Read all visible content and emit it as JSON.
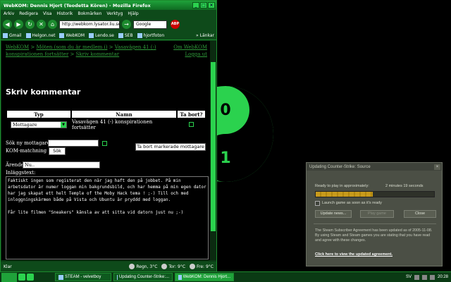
{
  "firefox": {
    "title": "WebKOM: Dennis Hjort (Teodetta Kören) - Mozilla Firefox",
    "menu": [
      "Arkiv",
      "Redigera",
      "Visa",
      "Historik",
      "Bokmärken",
      "Verktyg",
      "Hjälp"
    ],
    "url": "http://webkom.lysator.liu.se/",
    "search_value": "Google",
    "abp_label": "ABP",
    "bookmarks": [
      "Gmail",
      "Helgon.net",
      "WebKOM",
      "Lendo.se",
      "SEB",
      "hjortfoton"
    ],
    "bookmarks_more": "»",
    "bookmarks_overflow_label": "Länkar"
  },
  "page": {
    "breadcrumb": {
      "root": "WebKOM",
      "sep": " > ",
      "level1": "Möten (som du är medlem i)",
      "level2": "Vasavägen 41 (-) konspirationen fortsätter",
      "level3": "Skriv kommentar"
    },
    "right_links": [
      "Om WebKOM",
      "Logga ut"
    ],
    "title": "Skriv kommentar",
    "table": {
      "headers": [
        "Typ",
        "Namn",
        "Ta bort?"
      ],
      "row": {
        "type": "Mottagare",
        "name": "Vasavägen 41 (-) konspirationen fortsätter"
      }
    },
    "search_label": "Sök ny mottagare:",
    "kom_label": "KOM-matchning",
    "search_button": "Sök",
    "remove_button": "Ta bort markerade mottagare",
    "subject_label": "Ärende:",
    "subject_value": "Nu..",
    "body_label": "Inläggstext:",
    "body_text": "Faktiskt ingen som registerat den när jag haft den på jobbet. På min arbetsdator är numer loggan min bakgrundsbild, och har hemma på min egen dator har jag skapat ett helt Temple of the Moby Hack tema ! ;-) Till och med inloggningskärmen både på Vista och Ubuntu är pryddd med loggan.\n\nFår lite filmen \"Sneakers\" känsla av att sitta vid datorn just nu ;-)"
  },
  "statusbar": {
    "text": "Klar",
    "weather": [
      "Regn, 3°C",
      "Tor: 9°C",
      "Fre: 9°C"
    ]
  },
  "steam": {
    "title": "Updating Counter-Strike: Source",
    "ready_label": "Ready to play in approximately:",
    "time_left": "2 minutes 19 seconds",
    "progress": 0.48,
    "launch_label": "Launch game as soon as it's ready",
    "buttons": [
      "Update news...",
      "Play game",
      "Close"
    ],
    "agreement": "The Steam Subscriber Agreement has been updated as of 2005-11-08. By using Steam and Steam games you are stating that you have read and agree with these changes.",
    "link": "Click here to view the updated agreement."
  },
  "taskbar": {
    "items": [
      "STEAM - velvetboy",
      "Updating Counter-Strike:...",
      "WebKOM: Dennis Hjort..."
    ],
    "lang": "SV",
    "clock": "20:28"
  },
  "colors": {
    "accent": "#2bd24e",
    "link": "#2f9b3a",
    "steam_bg": "#4b4f45",
    "progress": "#c89b1c"
  }
}
